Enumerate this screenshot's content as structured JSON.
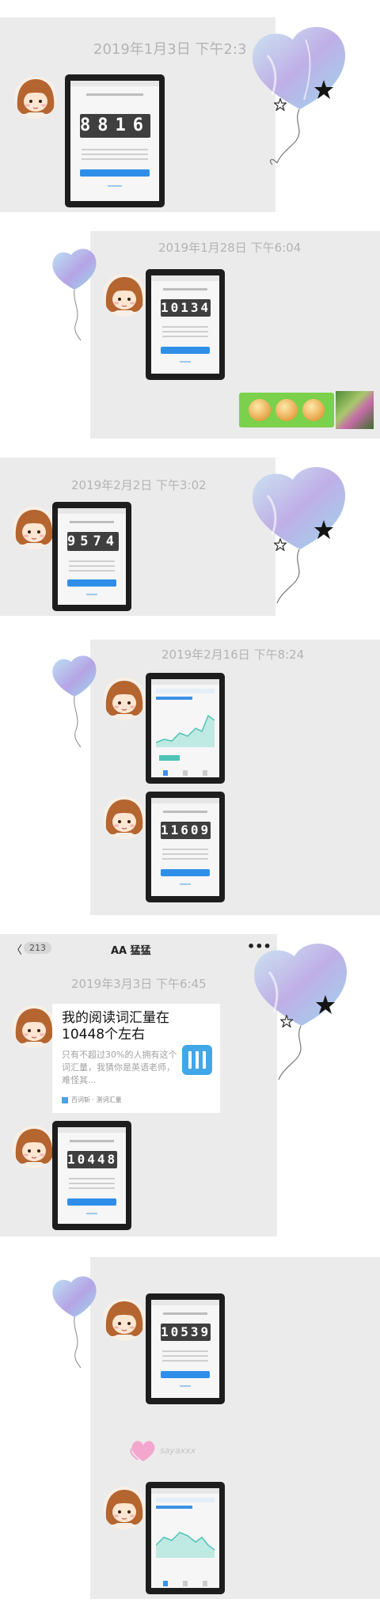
{
  "panels": [
    {
      "timestamp": "2019年1月3日 下午2:3",
      "cards": [
        {
          "score": "8816",
          "kind": "score"
        }
      ]
    },
    {
      "timestamp": "2019年1月28日 下午6:04",
      "cards": [
        {
          "score": "10134",
          "kind": "score"
        }
      ]
    },
    {
      "timestamp": "2019年2月2日 下午3:02",
      "cards": [
        {
          "score": "9574",
          "kind": "score"
        }
      ]
    },
    {
      "timestamp": "2019年2月16日 下午8:24",
      "cards": [
        {
          "kind": "chart"
        },
        {
          "score": "11609",
          "kind": "score"
        }
      ]
    },
    {
      "timestamp": "2019年3月3日 下午6:45",
      "cards": [
        {
          "score": "10448",
          "kind": "score"
        }
      ]
    },
    {
      "timestamp": "",
      "cards": [
        {
          "score": "10539",
          "kind": "score"
        },
        {
          "kind": "chart"
        }
      ]
    }
  ],
  "chat_header": {
    "back_arrow": "〈",
    "unread_count": "213",
    "title": "AA 猛猛",
    "more_icon": "•••"
  },
  "link_card": {
    "title": "我的阅读词汇量在10448个左右",
    "description": "只有不超过30%的人拥有这个词汇量，我猜你是英语老师，难怪其...",
    "footer": "百词斩 · 测词汇量"
  },
  "watermark": "sayaxxx",
  "colors": {
    "panel_bg": "#ebebeb",
    "timestamp": "#b4b4b4",
    "score_tile": "#3f3f3f",
    "accent_blue": "#2f8fe8",
    "chart_teal": "#4fc3b6",
    "sticker_green": "#7bd14b"
  },
  "icons": [
    "avatar-cartoon-girl",
    "balloon-heart-icon",
    "star-icon",
    "vocab-app-icon"
  ]
}
